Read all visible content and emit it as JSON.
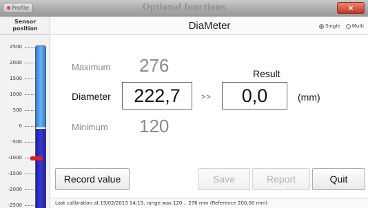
{
  "window": {
    "title": "Optional functions",
    "profile_label": "Profile",
    "close_label": "×"
  },
  "sensor_panel": {
    "title_line1": "Sensor",
    "title_line2": "position",
    "ticks": [
      "2500",
      "2000",
      "1500",
      "1000",
      "500",
      "0",
      "-500",
      "-1000",
      "-1500",
      "-2000",
      "-2500"
    ],
    "gauge_colors": {
      "positive": "#2b7fd6",
      "negative": "#1d1da6",
      "marker": "#e02020"
    }
  },
  "header": {
    "app_title": "DiaMeter",
    "modes": [
      {
        "label": "Single",
        "selected": true
      },
      {
        "label": "Multi",
        "selected": false
      }
    ]
  },
  "measure": {
    "maximum_label": "Maximum",
    "maximum_value": "276",
    "diameter_label": "Diameter",
    "diameter_value": "222,7",
    "arrows": ">>",
    "result_label": "Result",
    "result_value": "0,0",
    "unit": "(mm)",
    "minimum_label": "Minimum",
    "minimum_value": "120"
  },
  "buttons": {
    "record": "Record value",
    "save": "Save",
    "report": "Report",
    "quit": "Quit"
  },
  "status": {
    "text": "Last calibration at 19/02/2013 14:15, range was 120 .. 276 mm (Reference 200,00 mm)"
  }
}
